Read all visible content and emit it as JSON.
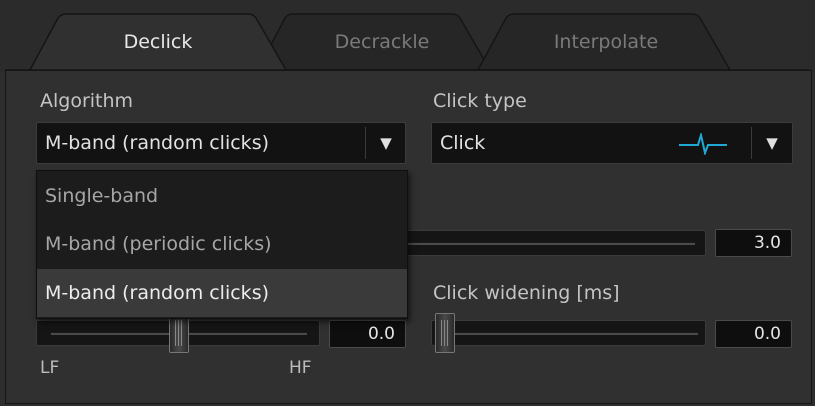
{
  "tabs": [
    {
      "label": "Declick",
      "active": true
    },
    {
      "label": "Decrackle",
      "active": false
    },
    {
      "label": "Interpolate",
      "active": false
    }
  ],
  "algorithm": {
    "label": "Algorithm",
    "selected": "M-band (random clicks)",
    "options": [
      "Single-band",
      "M-band (periodic clicks)",
      "M-band (random clicks)"
    ]
  },
  "click_type": {
    "label": "Click type",
    "selected": "Click",
    "icon": "click-waveform-icon",
    "icon_color": "#21a9d6"
  },
  "sensitivity": {
    "value": "3.0"
  },
  "frequency_skew": {
    "value": "0.0",
    "min_label": "LF",
    "max_label": "HF",
    "position": 0.5
  },
  "click_widening": {
    "label": "Click widening [ms]",
    "value": "0.0",
    "position": 0.0
  },
  "colors": {
    "accent": "#21a9d6",
    "panel": "#303030",
    "field": "#121212"
  }
}
